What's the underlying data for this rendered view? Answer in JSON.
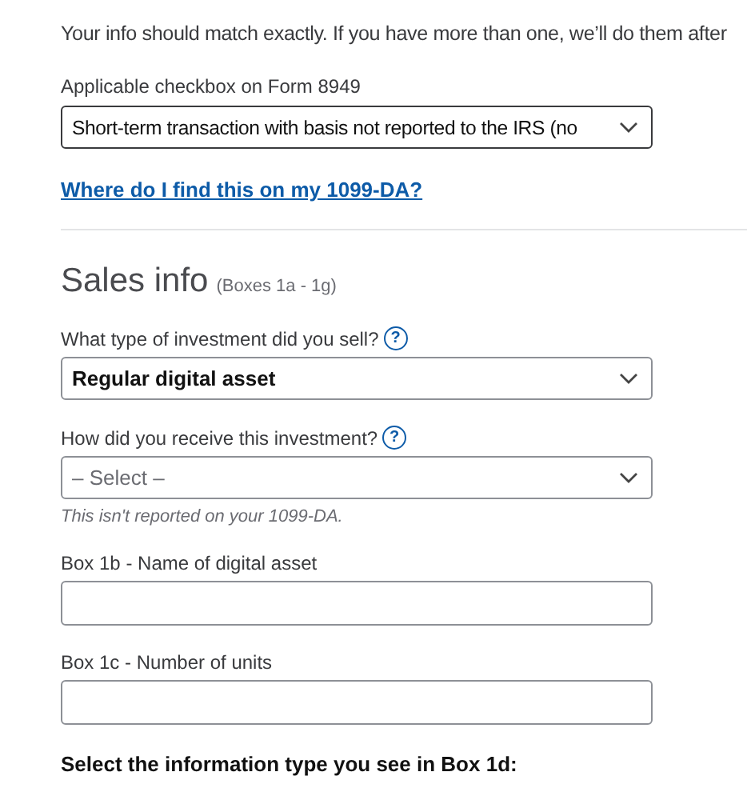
{
  "intro": "Your info should match exactly. If you have more than one, we’ll do them after",
  "form_checkbox": {
    "label": "Applicable checkbox on Form 8949",
    "value": "Short-term transaction with basis not reported to the IRS (no"
  },
  "help_link": "Where do I find this on my 1099-DA?",
  "section": {
    "title": "Sales info",
    "subtitle": "(Boxes 1a - 1g)"
  },
  "fields": [
    {
      "kind": "select",
      "label": "What type of investment did you sell?",
      "help": "?",
      "value": "Regular digital asset"
    },
    {
      "kind": "select",
      "label": "How did you receive this investment?",
      "help": "?",
      "placeholder": "– Select –",
      "note": "This isn't reported on your 1099-DA."
    },
    {
      "kind": "text",
      "label": "Box 1b - Name of digital asset"
    },
    {
      "kind": "text",
      "label": "Box 1c - Number of units"
    }
  ],
  "box_1d_prompt": "Select the information type you see in Box 1d:"
}
